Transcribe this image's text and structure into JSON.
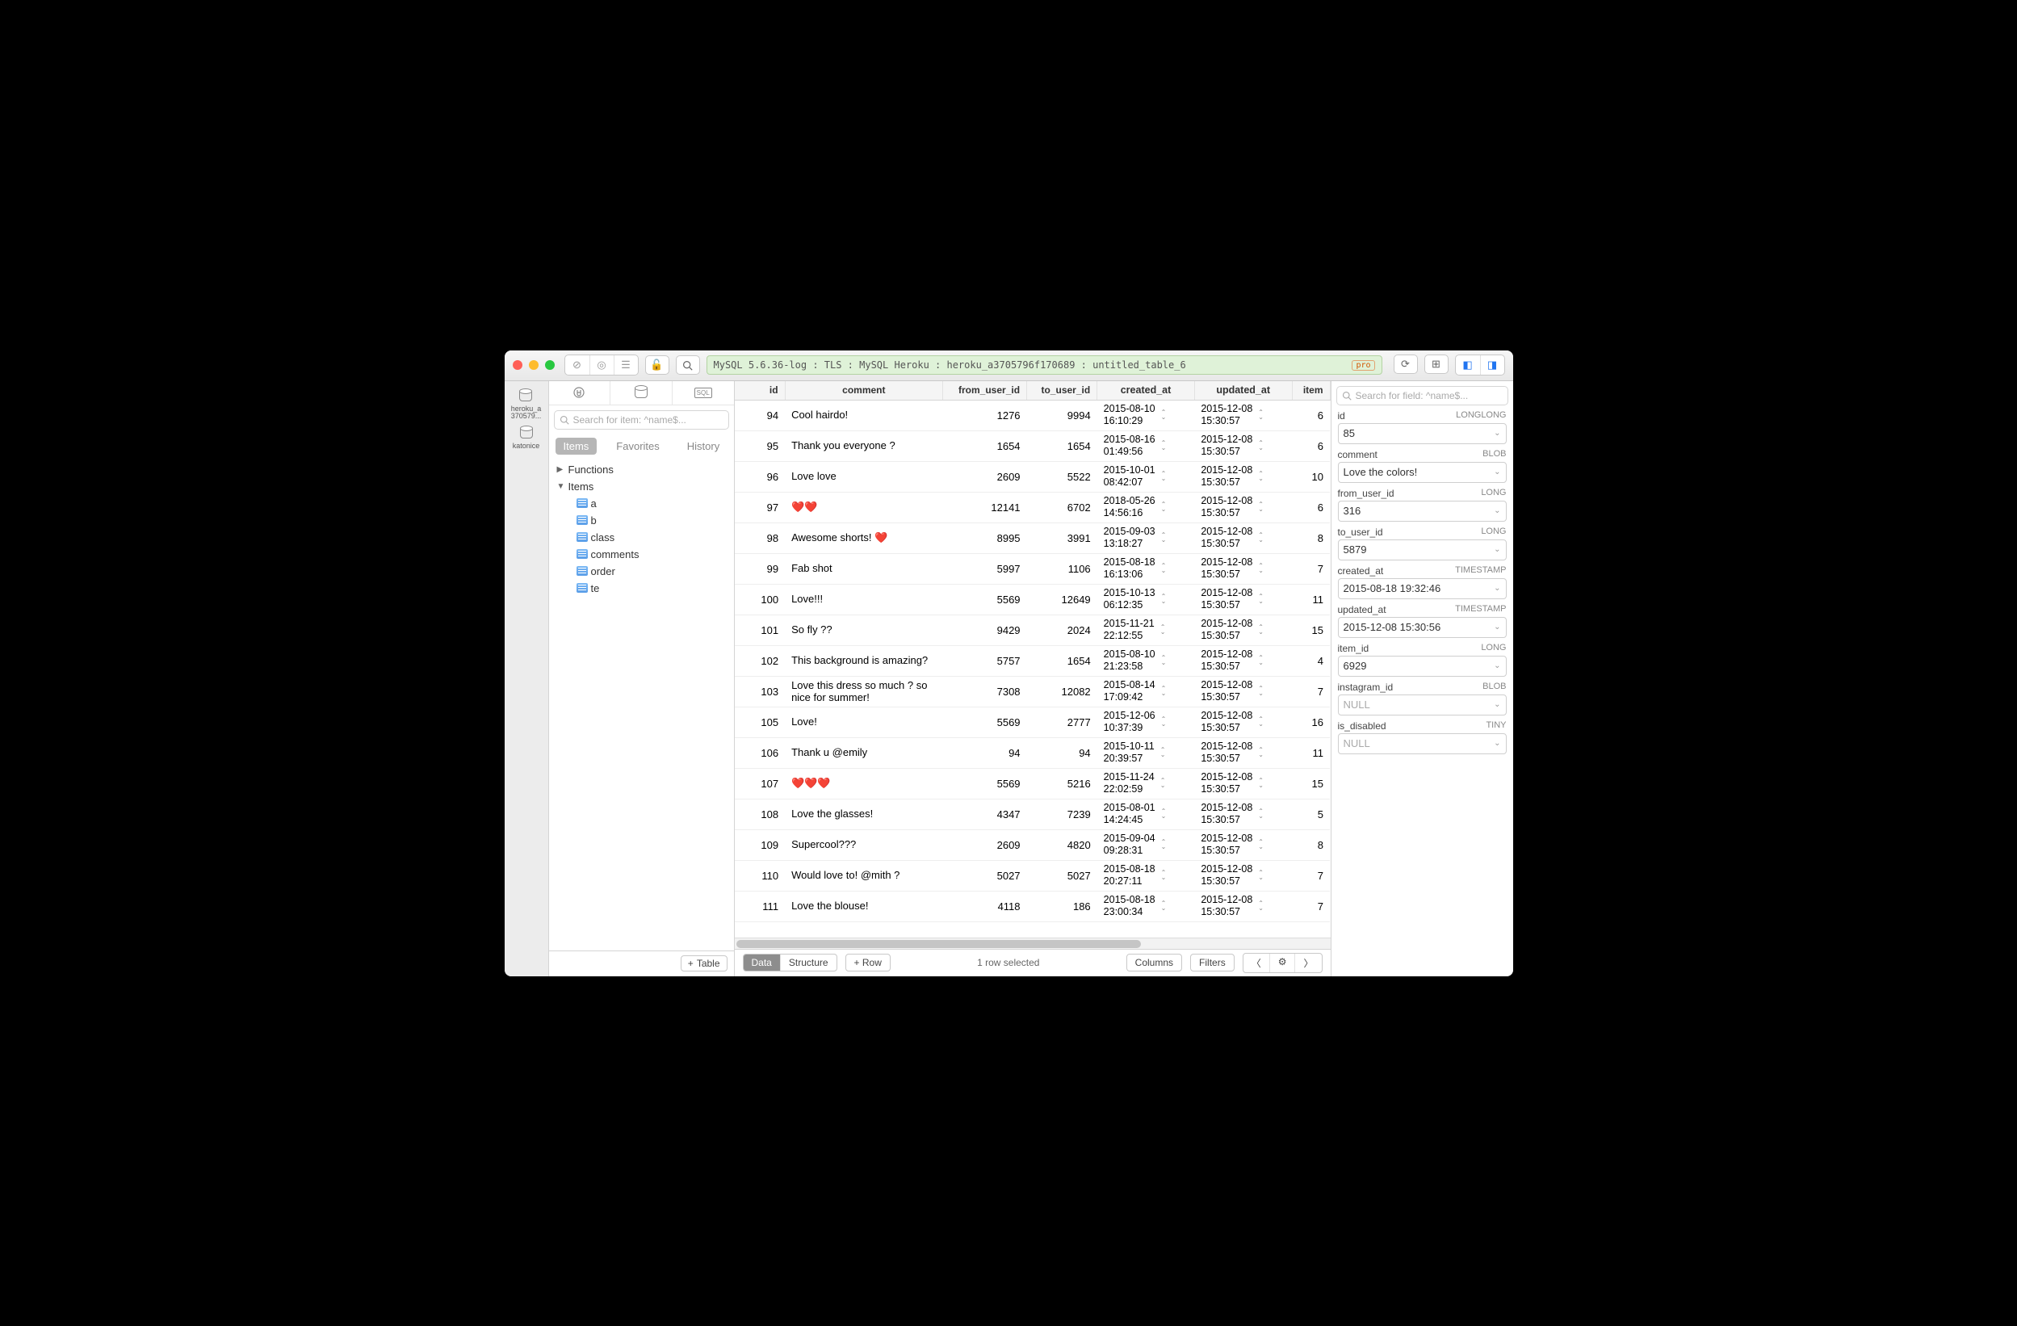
{
  "breadcrumb": "MySQL 5.6.36-log : TLS : MySQL Heroku : heroku_a3705796f170689 : untitled_table_6",
  "pro_badge": "pro",
  "left_rail": [
    {
      "label": "heroku_a\n370579..."
    },
    {
      "label": "katonice"
    }
  ],
  "sidebar": {
    "search_placeholder": "Search for item: ^name$...",
    "tabs": {
      "items": "Items",
      "favorites": "Favorites",
      "history": "History"
    },
    "tree": {
      "functions": "Functions",
      "items": "Items",
      "tables": [
        "a",
        "b",
        "class",
        "comments",
        "order",
        "te"
      ]
    },
    "add_table": "Table"
  },
  "grid": {
    "columns": [
      "id",
      "comment",
      "from_user_id",
      "to_user_id",
      "created_at",
      "updated_at",
      "item"
    ],
    "rows": [
      {
        "id": 94,
        "comment": "Cool hairdo!",
        "from": 1276,
        "to": 9994,
        "created": "2015-08-10\n16:10:29",
        "updated": "2015-12-08\n15:30:57",
        "item": "6"
      },
      {
        "id": 95,
        "comment": "Thank you everyone ?",
        "from": 1654,
        "to": 1654,
        "created": "2015-08-16\n01:49:56",
        "updated": "2015-12-08\n15:30:57",
        "item": "6"
      },
      {
        "id": 96,
        "comment": "Love love",
        "from": 2609,
        "to": 5522,
        "created": "2015-10-01\n08:42:07",
        "updated": "2015-12-08\n15:30:57",
        "item": "10"
      },
      {
        "id": 97,
        "comment": "❤️❤️",
        "from": 12141,
        "to": 6702,
        "created": "2018-05-26\n14:56:16",
        "updated": "2015-12-08\n15:30:57",
        "item": "6"
      },
      {
        "id": 98,
        "comment": "Awesome shorts! ❤️",
        "from": 8995,
        "to": 3991,
        "created": "2015-09-03\n13:18:27",
        "updated": "2015-12-08\n15:30:57",
        "item": "8"
      },
      {
        "id": 99,
        "comment": "Fab shot",
        "from": 5997,
        "to": 1106,
        "created": "2015-08-18\n16:13:06",
        "updated": "2015-12-08\n15:30:57",
        "item": "7"
      },
      {
        "id": 100,
        "comment": "Love!!!",
        "from": 5569,
        "to": 12649,
        "created": "2015-10-13\n06:12:35",
        "updated": "2015-12-08\n15:30:57",
        "item": "11"
      },
      {
        "id": 101,
        "comment": "So fly ??",
        "from": 9429,
        "to": 2024,
        "created": "2015-11-21\n22:12:55",
        "updated": "2015-12-08\n15:30:57",
        "item": "15"
      },
      {
        "id": 102,
        "comment": "This background is amazing?",
        "from": 5757,
        "to": 1654,
        "created": "2015-08-10\n21:23:58",
        "updated": "2015-12-08\n15:30:57",
        "item": "4"
      },
      {
        "id": 103,
        "comment": "Love this dress so much ? so nice for summer!",
        "from": 7308,
        "to": 12082,
        "created": "2015-08-14\n17:09:42",
        "updated": "2015-12-08\n15:30:57",
        "item": "7"
      },
      {
        "id": 105,
        "comment": "Love!",
        "from": 5569,
        "to": 2777,
        "created": "2015-12-06\n10:37:39",
        "updated": "2015-12-08\n15:30:57",
        "item": "16"
      },
      {
        "id": 106,
        "comment": "Thank u @emily",
        "from": 94,
        "to": 94,
        "created": "2015-10-11\n20:39:57",
        "updated": "2015-12-08\n15:30:57",
        "item": "11"
      },
      {
        "id": 107,
        "comment": "❤️❤️❤️",
        "from": 5569,
        "to": 5216,
        "created": "2015-11-24\n22:02:59",
        "updated": "2015-12-08\n15:30:57",
        "item": "15"
      },
      {
        "id": 108,
        "comment": "Love the glasses!",
        "from": 4347,
        "to": 7239,
        "created": "2015-08-01\n14:24:45",
        "updated": "2015-12-08\n15:30:57",
        "item": "5"
      },
      {
        "id": 109,
        "comment": "Supercool???",
        "from": 2609,
        "to": 4820,
        "created": "2015-09-04\n09:28:31",
        "updated": "2015-12-08\n15:30:57",
        "item": "8"
      },
      {
        "id": 110,
        "comment": "Would love to! @mith ?",
        "from": 5027,
        "to": 5027,
        "created": "2015-08-18\n20:27:11",
        "updated": "2015-12-08\n15:30:57",
        "item": "7"
      },
      {
        "id": 111,
        "comment": "Love the blouse!",
        "from": 4118,
        "to": 186,
        "created": "2015-08-18\n23:00:34",
        "updated": "2015-12-08\n15:30:57",
        "item": "7"
      }
    ]
  },
  "statusbar": {
    "data": "Data",
    "structure": "Structure",
    "row": "Row",
    "selected": "1 row selected",
    "columns": "Columns",
    "filters": "Filters"
  },
  "rightpanel": {
    "search_placeholder": "Search for field: ^name$...",
    "fields": [
      {
        "name": "id",
        "type": "LONGLONG",
        "value": "85"
      },
      {
        "name": "comment",
        "type": "BLOB",
        "value": "Love the colors!"
      },
      {
        "name": "from_user_id",
        "type": "LONG",
        "value": "316"
      },
      {
        "name": "to_user_id",
        "type": "LONG",
        "value": "5879"
      },
      {
        "name": "created_at",
        "type": "TIMESTAMP",
        "value": "2015-08-18 19:32:46"
      },
      {
        "name": "updated_at",
        "type": "TIMESTAMP",
        "value": "2015-12-08 15:30:56"
      },
      {
        "name": "item_id",
        "type": "LONG",
        "value": "6929"
      },
      {
        "name": "instagram_id",
        "type": "BLOB",
        "value": "NULL",
        "null": true
      },
      {
        "name": "is_disabled",
        "type": "TINY",
        "value": "NULL",
        "null": true
      }
    ]
  }
}
